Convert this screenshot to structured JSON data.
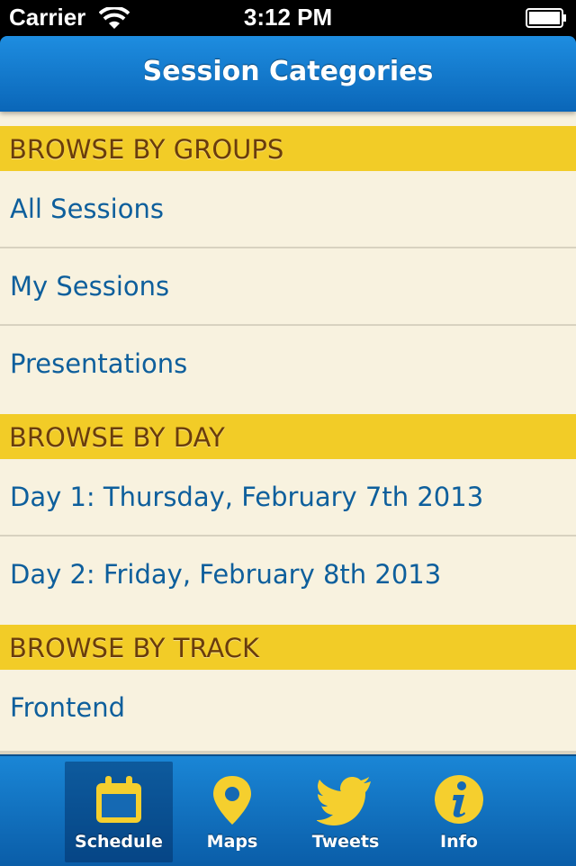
{
  "status_bar": {
    "carrier": "Carrier",
    "time": "3:12 PM"
  },
  "nav_bar": {
    "title": "Session Categories"
  },
  "sections": [
    {
      "header": "BROWSE BY GROUPS",
      "items": [
        "All Sessions",
        "My Sessions",
        "Presentations"
      ]
    },
    {
      "header": "BROWSE BY DAY",
      "items": [
        "Day 1: Thursday, February 7th 2013",
        "Day 2: Friday, February 8th 2013"
      ]
    },
    {
      "header": "BROWSE BY TRACK",
      "items": [
        "Frontend"
      ]
    }
  ],
  "tab_bar": {
    "tabs": [
      {
        "label": "Schedule",
        "icon": "calendar-icon",
        "selected": true
      },
      {
        "label": "Maps",
        "icon": "map-pin-icon",
        "selected": false
      },
      {
        "label": "Tweets",
        "icon": "twitter-bird-icon",
        "selected": false
      },
      {
        "label": "Info",
        "icon": "info-icon",
        "selected": false
      }
    ]
  },
  "colors": {
    "nav_blue": "#0a66b8",
    "section_yellow": "#f2cc27",
    "section_text": "#6a3d0c",
    "row_text": "#0e5f9c",
    "background": "#f8f2df",
    "icon_yellow": "#f5cf2e"
  }
}
